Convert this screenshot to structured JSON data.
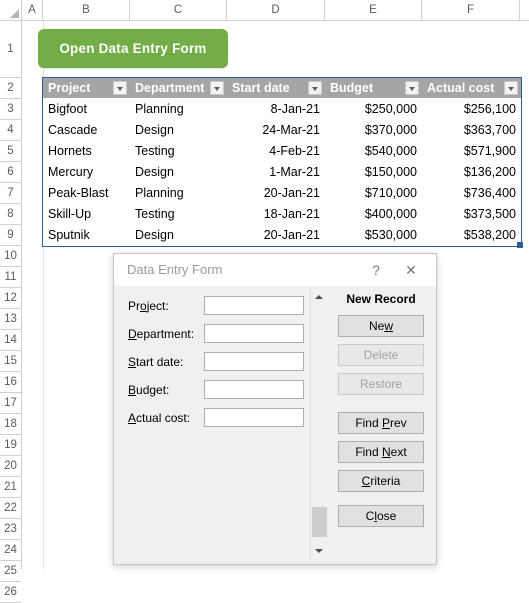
{
  "spreadsheet": {
    "column_headers": [
      "A",
      "B",
      "C",
      "D",
      "E",
      "F"
    ],
    "row_headers": [
      "1",
      "2",
      "3",
      "4",
      "5",
      "6",
      "7",
      "8",
      "9",
      "10",
      "11",
      "12",
      "13",
      "14",
      "15",
      "16",
      "17",
      "18",
      "19",
      "20",
      "21",
      "22",
      "23",
      "24",
      "25",
      "26"
    ],
    "macro_button_label": "Open Data Entry Form",
    "accent_green": "#72ad48",
    "header_gray": "#a5a5a5",
    "selection_blue": "#2a6099",
    "table": {
      "columns": [
        "Project",
        "Department",
        "Start date",
        "Budget",
        "Actual cost"
      ],
      "rows": [
        {
          "project": "Bigfoot",
          "department": "Planning",
          "start_date": "8-Jan-21",
          "budget": "$250,000",
          "actual_cost": "$256,100"
        },
        {
          "project": "Cascade",
          "department": "Design",
          "start_date": "24-Mar-21",
          "budget": "$370,000",
          "actual_cost": "$363,700"
        },
        {
          "project": "Hornets",
          "department": "Testing",
          "start_date": "4-Feb-21",
          "budget": "$540,000",
          "actual_cost": "$571,900"
        },
        {
          "project": "Mercury",
          "department": "Design",
          "start_date": "1-Mar-21",
          "budget": "$150,000",
          "actual_cost": "$136,200"
        },
        {
          "project": "Peak-Blast",
          "department": "Planning",
          "start_date": "20-Jan-21",
          "budget": "$710,000",
          "actual_cost": "$736,400"
        },
        {
          "project": "Skill-Up",
          "department": "Testing",
          "start_date": "18-Jan-21",
          "budget": "$400,000",
          "actual_cost": "$373,500"
        },
        {
          "project": "Sputnik",
          "department": "Design",
          "start_date": "20-Jan-21",
          "budget": "$530,000",
          "actual_cost": "$538,200"
        }
      ]
    }
  },
  "dialog": {
    "title": "Data Entry Form",
    "help_icon": "?",
    "close_icon": "✕",
    "record_status": "New Record",
    "fields": [
      {
        "label_pre": "Pr",
        "accel": "o",
        "label_post": "ject:",
        "value": "",
        "name": "project"
      },
      {
        "label_pre": "",
        "accel": "D",
        "label_post": "epartment:",
        "value": "",
        "name": "department"
      },
      {
        "label_pre": "",
        "accel": "S",
        "label_post": "tart date:",
        "value": "",
        "name": "start-date"
      },
      {
        "label_pre": "",
        "accel": "B",
        "label_post": "udget:",
        "value": "",
        "name": "budget"
      },
      {
        "label_pre": "",
        "accel": "A",
        "label_post": "ctual cost:",
        "value": "",
        "name": "actual-cost"
      }
    ],
    "buttons": [
      {
        "pre": "Ne",
        "accel": "w",
        "post": "",
        "name": "new",
        "enabled": true
      },
      {
        "pre": "Delete",
        "accel": "",
        "post": "",
        "name": "delete",
        "enabled": false
      },
      {
        "pre": "Restore",
        "accel": "",
        "post": "",
        "name": "restore",
        "enabled": false
      },
      {
        "pre": "Find ",
        "accel": "P",
        "post": "rev",
        "name": "find-prev",
        "enabled": true
      },
      {
        "pre": "Find ",
        "accel": "N",
        "post": "ext",
        "name": "find-next",
        "enabled": true
      },
      {
        "pre": "",
        "accel": "C",
        "post": "riteria",
        "name": "criteria",
        "enabled": true
      },
      {
        "pre": "C",
        "accel": "l",
        "post": "ose",
        "name": "close",
        "enabled": true
      }
    ]
  }
}
